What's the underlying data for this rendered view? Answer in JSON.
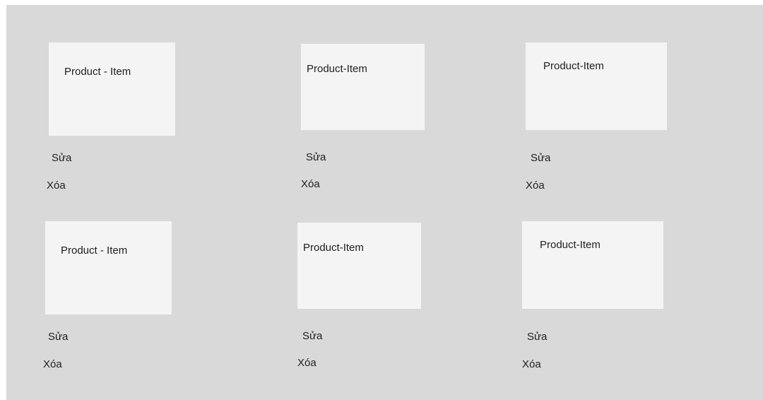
{
  "items": [
    {
      "title": "Product - Item",
      "edit_label": "Sửa",
      "delete_label": "Xóa"
    },
    {
      "title": "Product-Item",
      "edit_label": "Sửa",
      "delete_label": "Xóa"
    },
    {
      "title": "Product-Item",
      "edit_label": "Sửa",
      "delete_label": "Xóa"
    },
    {
      "title": "Product - Item",
      "edit_label": "Sửa",
      "delete_label": "Xóa"
    },
    {
      "title": "Product-Item",
      "edit_label": "Sửa",
      "delete_label": "Xóa"
    },
    {
      "title": "Product-Item",
      "edit_label": "Sửa",
      "delete_label": "Xóa"
    }
  ],
  "colors": {
    "board_background": "#d9d9d9",
    "card_background": "#f4f4f4",
    "text": "#1e1e1e"
  }
}
